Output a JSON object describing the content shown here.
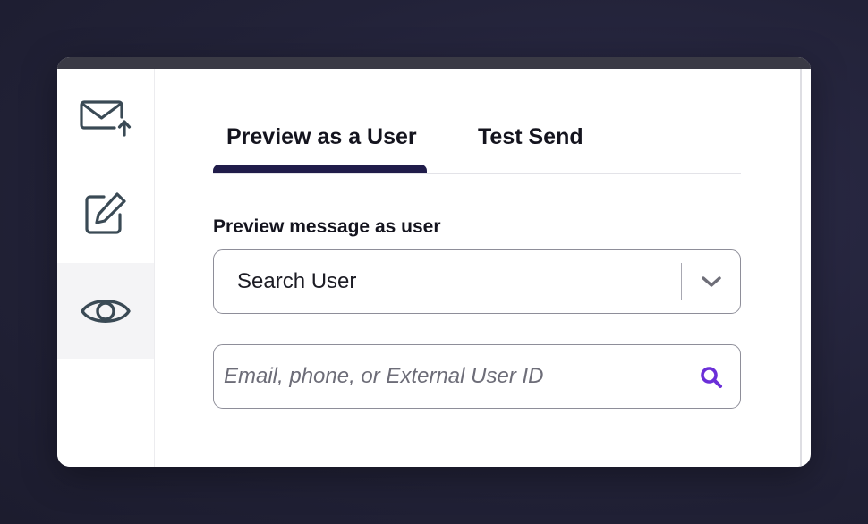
{
  "colors": {
    "accent": "#201c4a",
    "search_icon": "#6b2fd8",
    "icon_stroke": "#3a4a55",
    "text": "#14141e"
  },
  "sidebar": {
    "items": [
      {
        "icon": "mail-send-icon",
        "active": false
      },
      {
        "icon": "edit-icon",
        "active": false
      },
      {
        "icon": "eye-icon",
        "active": true
      }
    ]
  },
  "tabs": [
    {
      "label": "Preview as a User",
      "active": true
    },
    {
      "label": "Test Send",
      "active": false
    }
  ],
  "preview": {
    "label": "Preview message as user",
    "select_value": "Search User",
    "search_placeholder": "Email, phone, or External User ID",
    "search_value": ""
  }
}
